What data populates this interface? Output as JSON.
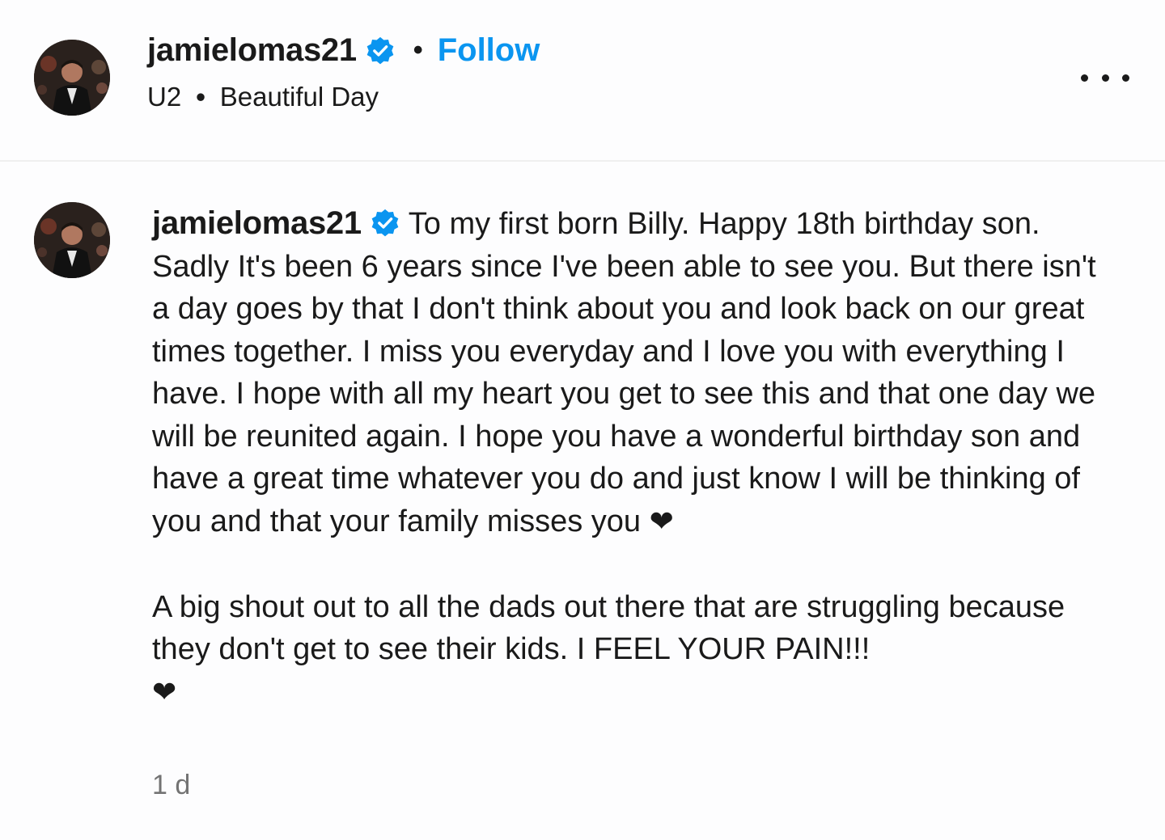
{
  "header": {
    "username": "jamielomas21",
    "separator": "•",
    "follow_label": "Follow",
    "music": {
      "artist": "U2",
      "separator": "•",
      "song": "Beautiful Day"
    },
    "more_icon": "more-horizontal-icon"
  },
  "caption": {
    "username": "jamielomas21",
    "paragraph1": "To my first born Billy. Happy 18th birthday son. Sadly It's been 6 years since I've been able to see you. But there isn't a day goes by that I don't think about you and look back on our great times together. I miss you everyday and I love you with everything I have. I hope with all my heart you get to see this and that one day we will be reunited again. I hope you have a wonderful birthday son and have a great time whatever you do and just know I will be thinking of you and that your family misses you",
    "heart1": "❤",
    "paragraph2": "A big shout out to all the dads out there that are struggling because they don't get to see their kids. I FEEL YOUR PAIN!!!",
    "heart2": "❤",
    "timestamp": "1 d"
  },
  "colors": {
    "accent": "#0a95f0",
    "verified_badge": "#0a95f0",
    "text": "#1a1a1a",
    "muted": "#737373",
    "divider": "#efefef"
  }
}
